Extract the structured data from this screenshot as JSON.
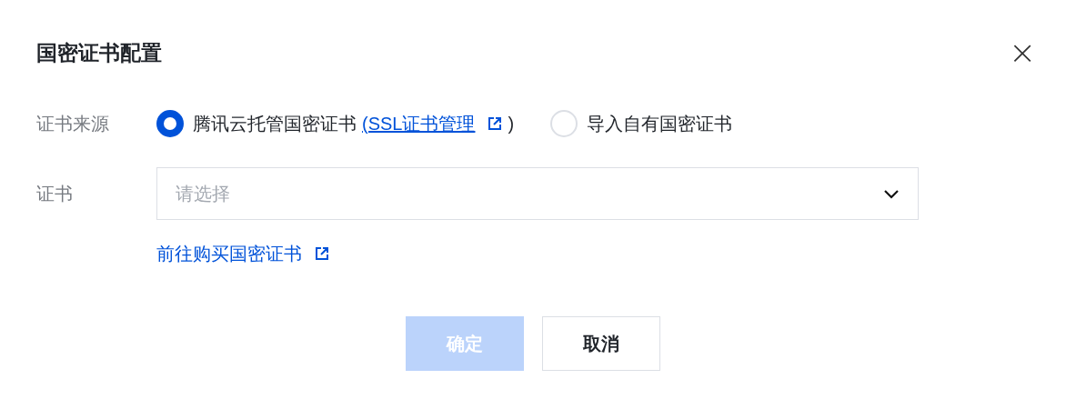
{
  "dialog": {
    "title": "国密证书配置",
    "close": "×"
  },
  "source": {
    "label": "证书来源",
    "options": [
      {
        "label": "腾讯云托管国密证书",
        "link": "(SSL证书管理",
        "suffix": ")",
        "selected": true
      },
      {
        "label": "导入自有国密证书",
        "selected": false
      }
    ]
  },
  "certificate": {
    "label": "证书",
    "placeholder": "请选择"
  },
  "buy_link": "前往购买国密证书",
  "buttons": [
    {
      "label": "确定",
      "kind": "primary",
      "disabled": true
    },
    {
      "label": "取消",
      "kind": "secondary",
      "disabled": false
    }
  ]
}
